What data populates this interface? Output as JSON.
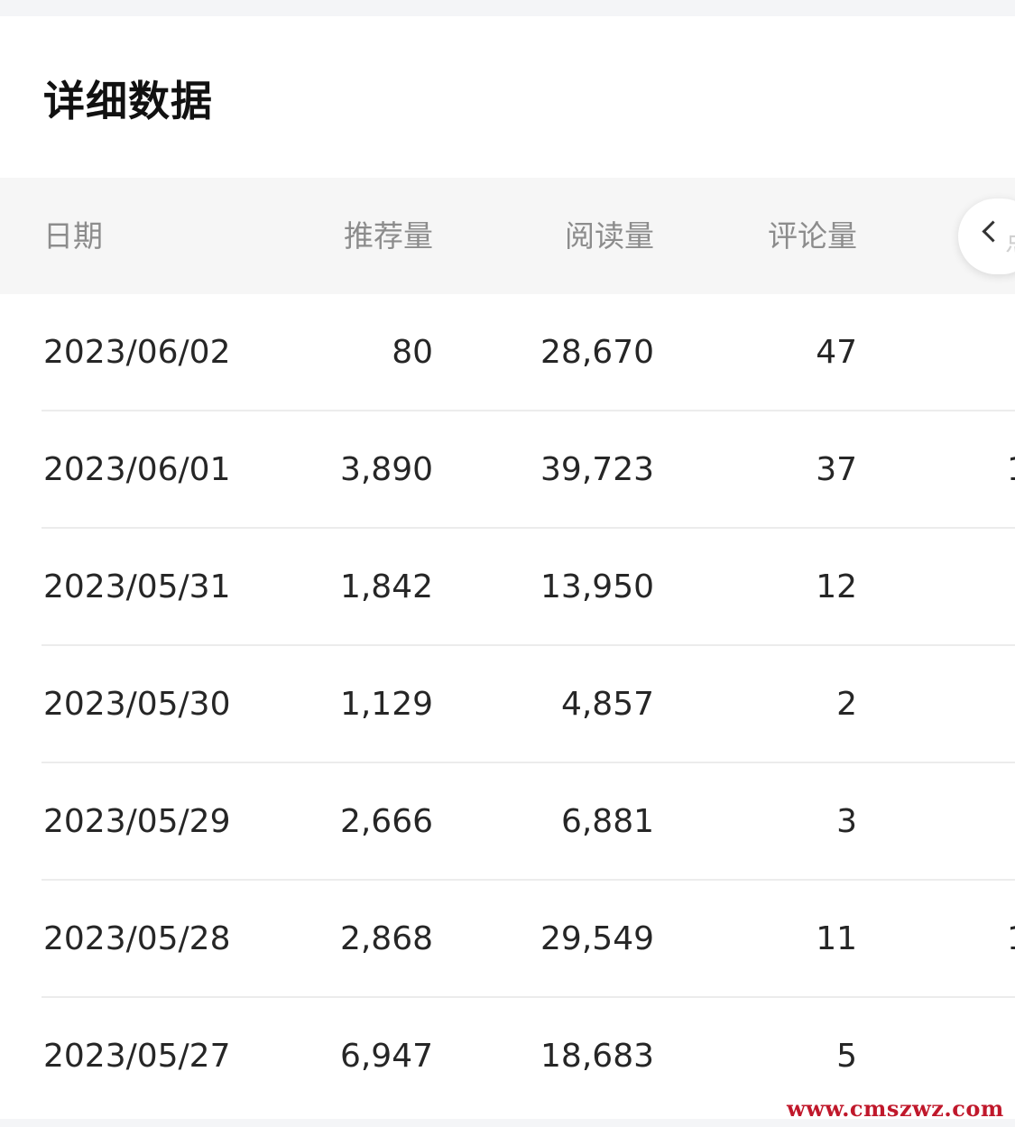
{
  "section": {
    "title": "详细数据"
  },
  "table": {
    "headers": {
      "date": "日期",
      "recommend": "推荐量",
      "read": "阅读量",
      "comment": "评论量",
      "fifth_peek": "点"
    },
    "rows": [
      {
        "date": "2023/06/02",
        "recommend": "80",
        "read": "28,670",
        "comment": "47",
        "fifth_peek": ""
      },
      {
        "date": "2023/06/01",
        "recommend": "3,890",
        "read": "39,723",
        "comment": "37",
        "fifth_peek": "1"
      },
      {
        "date": "2023/05/31",
        "recommend": "1,842",
        "read": "13,950",
        "comment": "12",
        "fifth_peek": ""
      },
      {
        "date": "2023/05/30",
        "recommend": "1,129",
        "read": "4,857",
        "comment": "2",
        "fifth_peek": ""
      },
      {
        "date": "2023/05/29",
        "recommend": "2,666",
        "read": "6,881",
        "comment": "3",
        "fifth_peek": ""
      },
      {
        "date": "2023/05/28",
        "recommend": "2,868",
        "read": "29,549",
        "comment": "11",
        "fifth_peek": "1"
      },
      {
        "date": "2023/05/27",
        "recommend": "6,947",
        "read": "18,683",
        "comment": "5",
        "fifth_peek": ""
      }
    ]
  },
  "collapse_button": {
    "icon": "chevron-left-icon"
  },
  "watermark": {
    "text": "www.cmszwz.com"
  },
  "colors": {
    "header_bg": "#f6f6f6",
    "header_text": "#8c8c8c",
    "watermark": "#c0182b"
  }
}
